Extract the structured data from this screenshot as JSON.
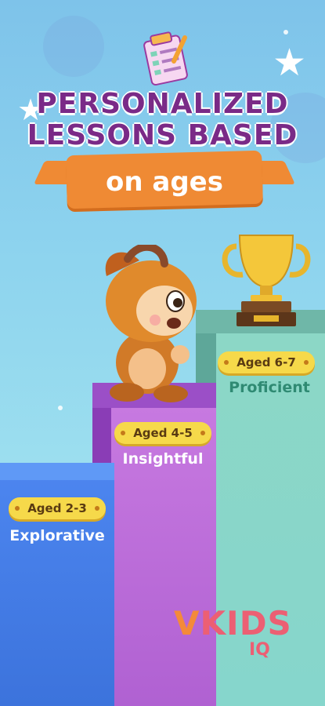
{
  "title": {
    "line1": "PERSONALIZED",
    "line2": "LESSONS BASED",
    "ribbon": "on ages"
  },
  "levels": [
    {
      "age": "Aged 2-3",
      "name": "Explorative"
    },
    {
      "age": "Aged 4-5",
      "name": "Insightful"
    },
    {
      "age": "Aged 6-7",
      "name": "Proficient"
    }
  ],
  "brand": {
    "logo": "VKIDS",
    "sub": "IQ"
  },
  "colors": {
    "title": "#7a2a87",
    "ribbon": "#ef8a34",
    "pill": "#f6d94a",
    "proficient_text": "#2f8a73"
  },
  "icons": [
    "clipboard-icon",
    "star-icon",
    "trophy-icon",
    "monkey-character-icon"
  ]
}
